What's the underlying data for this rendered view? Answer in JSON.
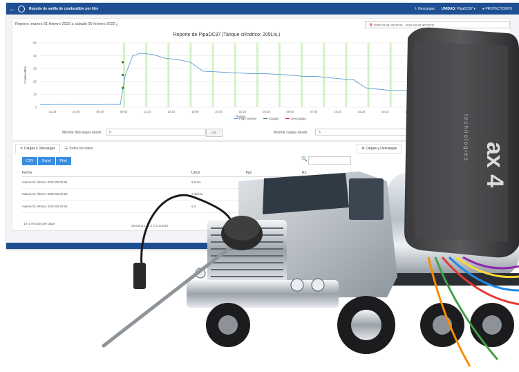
{
  "app": {
    "title": "Reporte de varilla de combustible por litro",
    "back_icon": "back-arrow-icon",
    "nav": {
      "descargas": "Descargas",
      "unidad_label": "UNIDAD:",
      "unidad_value": "PipaDC97",
      "company": "PROYECTOGPS"
    }
  },
  "report": {
    "range_prefix": "Reporte:",
    "range_text": "martes 01 febrero 2022 a sábado 05 febrero 2022",
    "date_range": "2022-02-01 00:00:00 - 2022-02-05 00:00:00"
  },
  "filters": {
    "descargas_label": "Mostrar descargas desde:",
    "descargas_value": "5",
    "unit_button": "Lts.",
    "cargas_label": "Mostrar cargas desde:",
    "cargas_value": "5"
  },
  "chart_data": {
    "type": "line",
    "title": "Reporte de PipaDC97 (Tanque cilíndrico: 205Lts.)",
    "xlabel": "Tiempo",
    "ylabel": "Combustible",
    "ylim": [
      0,
      50
    ],
    "yticks": [
      "0",
      "10",
      "20",
      "30",
      "40",
      "50"
    ],
    "xticks": [
      "01:30",
      "04:00",
      "06:30",
      "09:40",
      "13:20",
      "15:10",
      "18:00",
      "20:40",
      "02:20",
      "04:45",
      "06:50",
      "07:50",
      "16:44",
      "15:20",
      "18:15",
      "19:00",
      "21:40"
    ],
    "grid": true,
    "legend_position": "bottom",
    "series": [
      {
        "name": "Flujo normal",
        "color": "#5b9bd5",
        "x": [
          0,
          1,
          2,
          3,
          3.2,
          3.4,
          3.7,
          4,
          4.5,
          5,
          5.5,
          6,
          6.5,
          7,
          7.5,
          8,
          8.5,
          9,
          9.5,
          10,
          10.5,
          11,
          11.5,
          12,
          12.5,
          13,
          13.5,
          14,
          14.5,
          15,
          15.5,
          16
        ],
        "y": [
          2,
          2.1,
          2,
          2.2,
          2,
          25,
          40,
          42,
          41,
          38,
          37,
          35,
          28,
          27.5,
          27,
          26.5,
          26,
          26,
          25.5,
          25,
          24,
          24,
          23,
          22,
          21.5,
          15,
          14,
          13,
          13,
          12,
          11,
          10
        ]
      },
      {
        "name": "Cargas",
        "color": "#2e7d32"
      },
      {
        "name": "Descargas",
        "color": "#c62828"
      }
    ],
    "load_markers_y": [
      15,
      25,
      35
    ],
    "green_band_count": 14
  },
  "tabs": {
    "cargas_descargas": "Cargas y Descargas",
    "todos": "Todos los datos",
    "right_tab": "Cargas y Descargas"
  },
  "export_buttons": [
    "CSV",
    "Excel",
    "Print"
  ],
  "table": {
    "headers": {
      "fecha": "Fecha",
      "litros": "Litros",
      "tipo": "Tipo",
      "extra": "Ru"
    },
    "rows": [
      {
        "fecha": "martes 01 febrero 2022 08:25:54",
        "litros": "9.5 Lts."
      },
      {
        "fecha": "martes 01 febrero 2022 08:31:53",
        "litros": "7.15 Lts."
      },
      {
        "fecha": "martes 01 febrero 2022 08:34:53",
        "litros": "9.2"
      }
    ],
    "page_size": "10",
    "records_per_page": "records per page",
    "showing": "Showing 1 to 3 of 3 entries"
  },
  "device": {
    "brand_text": "ax 4",
    "sub_text": "technologies"
  }
}
